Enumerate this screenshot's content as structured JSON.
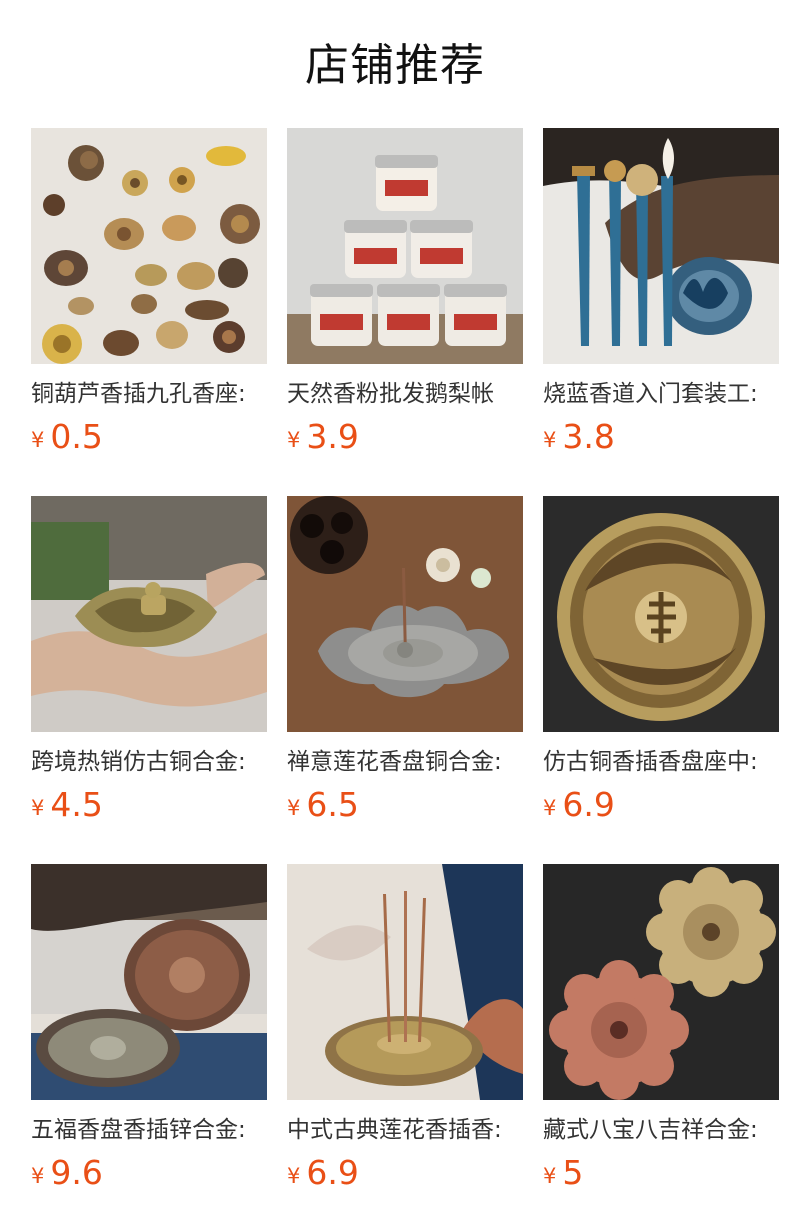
{
  "page": {
    "title": "店铺推荐"
  },
  "products": [
    {
      "name": "铜葫芦香插九孔香座:",
      "currency": "¥",
      "price": "0.5",
      "image_icon": "incense-holders-collection-icon",
      "colors": {
        "bg": "#e8e4de",
        "accent": "#b58d55",
        "accent2": "#5d3f2a",
        "accent3": "#d9b34a"
      }
    },
    {
      "name": "天然香粉批发鹅梨帐",
      "currency": "¥",
      "price": "3.9",
      "image_icon": "incense-powder-jars-icon",
      "colors": {
        "bg": "#d7d7d5",
        "accent": "#f4efe7",
        "accent2": "#c9b89b",
        "accent3": "#c03a31"
      }
    },
    {
      "name": "烧蓝香道入门套装工:",
      "currency": "¥",
      "price": "3.8",
      "image_icon": "incense-tool-set-icon",
      "colors": {
        "bg": "#eae8e4",
        "accent": "#2f6f95",
        "accent2": "#b68b44",
        "accent3": "#5a4333"
      }
    },
    {
      "name": "跨境热销仿古铜合金:",
      "currency": "¥",
      "price": "4.5",
      "image_icon": "lotus-holder-in-hand-icon",
      "colors": {
        "bg": "#cfcbc6",
        "accent": "#9c8d54",
        "accent2": "#d8b79a",
        "accent3": "#6d6034"
      }
    },
    {
      "name": "禅意莲花香盘铜合金:",
      "currency": "¥",
      "price": "6.5",
      "image_icon": "lotus-incense-plate-icon",
      "colors": {
        "bg": "#7f5538",
        "accent": "#8e8e8d",
        "accent2": "#a7a7a4",
        "accent3": "#2d1f18"
      }
    },
    {
      "name": "仿古铜香插香盘座中:",
      "currency": "¥",
      "price": "6.9",
      "image_icon": "dragon-fortune-plate-icon",
      "colors": {
        "bg": "#2b2b2b",
        "accent": "#b79d5e",
        "accent2": "#8a6b36",
        "accent3": "#d8c088"
      }
    },
    {
      "name": "五福香盘香插锌合金:",
      "currency": "¥",
      "price": "9.6",
      "image_icon": "five-blessings-plates-icon",
      "colors": {
        "bg": "#d6d3cf",
        "accent": "#8d5d47",
        "accent2": "#8e8a79",
        "accent3": "#5a4b41"
      }
    },
    {
      "name": "中式古典莲花香插香:",
      "currency": "¥",
      "price": "6.9",
      "image_icon": "classical-lotus-stick-holder-icon",
      "colors": {
        "bg": "#e6e0d8",
        "accent": "#b59a5a",
        "accent2": "#1d3658",
        "accent3": "#b56d4e"
      }
    },
    {
      "name": "藏式八宝八吉祥合金:",
      "currency": "¥",
      "price": "5",
      "image_icon": "eight-treasures-incense-plates-icon",
      "colors": {
        "bg": "#272727",
        "accent": "#c8b07c",
        "accent2": "#c37a64",
        "accent3": "#8b6f42"
      }
    }
  ]
}
